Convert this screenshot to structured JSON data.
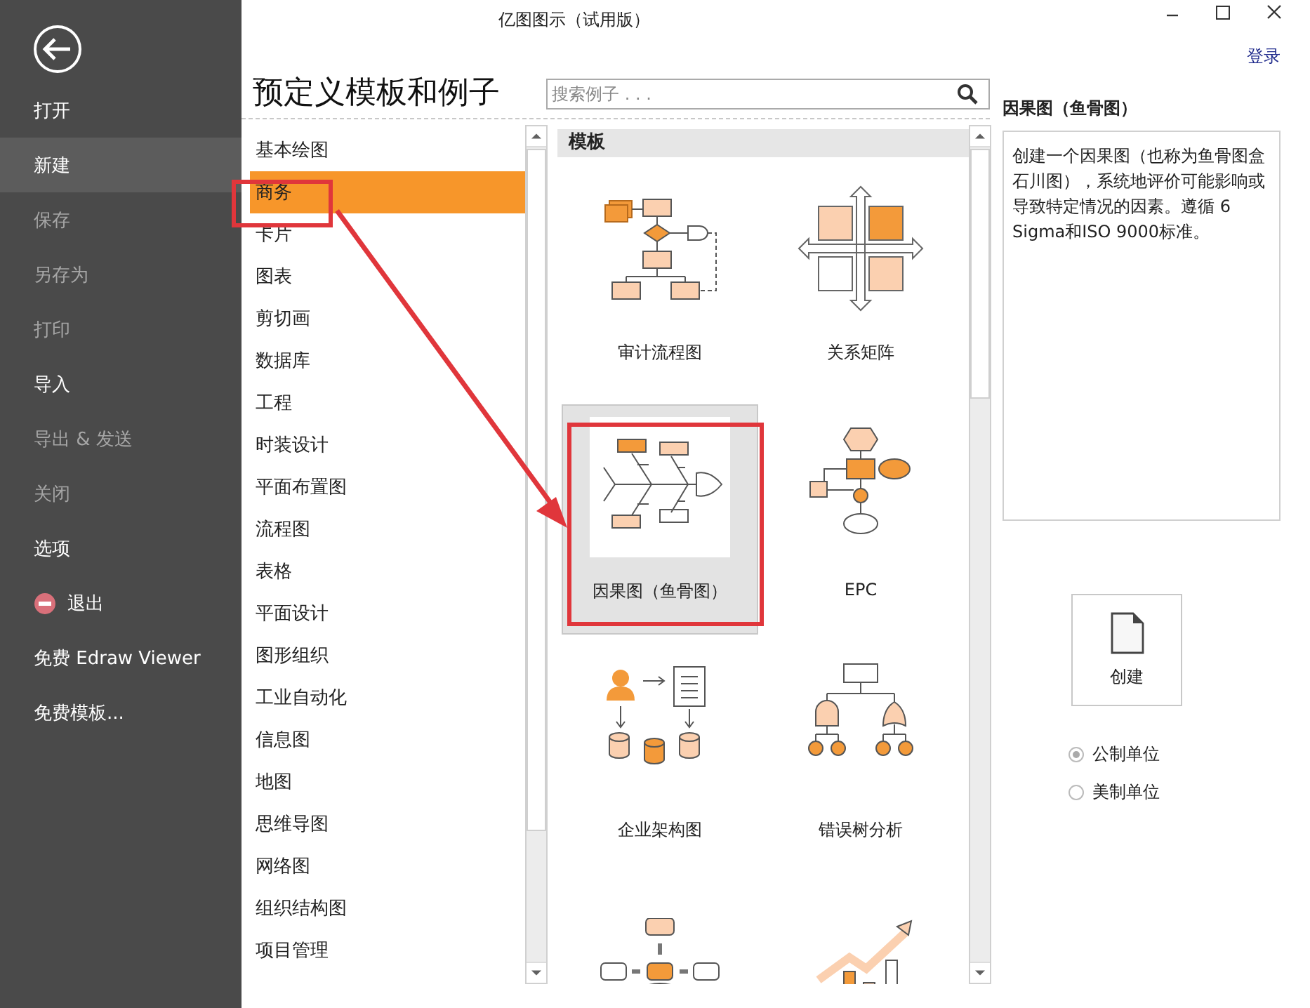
{
  "window": {
    "title": "亿图图示（试用版）",
    "login": "登录"
  },
  "sidebar": {
    "items": [
      {
        "label": "打开",
        "kind": "text",
        "disabled": false,
        "selected": false
      },
      {
        "label": "新建",
        "kind": "text",
        "disabled": false,
        "selected": true
      },
      {
        "label": "保存",
        "kind": "text",
        "disabled": true,
        "selected": false
      },
      {
        "label": "另存为",
        "kind": "text",
        "disabled": true,
        "selected": false
      },
      {
        "label": "打印",
        "kind": "text",
        "disabled": true,
        "selected": false
      },
      {
        "label": "导入",
        "kind": "text",
        "disabled": false,
        "selected": false
      },
      {
        "label": "导出 & 发送",
        "kind": "text",
        "disabled": true,
        "selected": false
      },
      {
        "label": "关闭",
        "kind": "text",
        "disabled": true,
        "selected": false
      },
      {
        "label": "选项",
        "kind": "text",
        "disabled": false,
        "selected": false
      },
      {
        "label": "退出",
        "kind": "exit",
        "disabled": false,
        "selected": false
      },
      {
        "label": "免费 Edraw Viewer",
        "kind": "text",
        "disabled": false,
        "selected": false
      },
      {
        "label": "免费模板...",
        "kind": "text",
        "disabled": false,
        "selected": false
      }
    ]
  },
  "heading": "预定义模板和例子",
  "search": {
    "placeholder": "搜索例子 . . ."
  },
  "categories": [
    {
      "label": "基本绘图",
      "selected": false
    },
    {
      "label": "商务",
      "selected": true
    },
    {
      "label": "卡片",
      "selected": false
    },
    {
      "label": "图表",
      "selected": false
    },
    {
      "label": "剪切画",
      "selected": false
    },
    {
      "label": "数据库",
      "selected": false
    },
    {
      "label": "工程",
      "selected": false
    },
    {
      "label": "时装设计",
      "selected": false
    },
    {
      "label": "平面布置图",
      "selected": false
    },
    {
      "label": "流程图",
      "selected": false
    },
    {
      "label": "表格",
      "selected": false
    },
    {
      "label": "平面设计",
      "selected": false
    },
    {
      "label": "图形组织",
      "selected": false
    },
    {
      "label": "工业自动化",
      "selected": false
    },
    {
      "label": "信息图",
      "selected": false
    },
    {
      "label": "地图",
      "selected": false
    },
    {
      "label": "思维导图",
      "selected": false
    },
    {
      "label": "网络图",
      "selected": false
    },
    {
      "label": "组织结构图",
      "selected": false
    },
    {
      "label": "项目管理",
      "selected": false
    }
  ],
  "templates": {
    "header": "模板",
    "items": [
      {
        "kind": "flowchart",
        "label": "审计流程图",
        "selected": false
      },
      {
        "kind": "matrix",
        "label": "关系矩阵",
        "selected": false
      },
      {
        "kind": "fishbone",
        "label": "因果图（鱼骨图）",
        "selected": true
      },
      {
        "kind": "epc",
        "label": "EPC",
        "selected": false
      },
      {
        "kind": "enterprise",
        "label": "企业架构图",
        "selected": false
      },
      {
        "kind": "faulttree",
        "label": "错误树分析",
        "selected": false
      },
      {
        "kind": "hub",
        "selected": false
      },
      {
        "kind": "growth",
        "selected": false
      }
    ]
  },
  "details": {
    "title": "因果图（鱼骨图）",
    "description": "创建一个因果图（也称为鱼骨图盒石川图），系统地评价可能影响或导致特定情况的因素。遵循 6 Sigma和ISO 9000标准。"
  },
  "create_button": "创建",
  "units": [
    {
      "label": "公制单位",
      "selected": true
    },
    {
      "label": "美制单位",
      "selected": false
    }
  ],
  "tutorial_marks": true
}
